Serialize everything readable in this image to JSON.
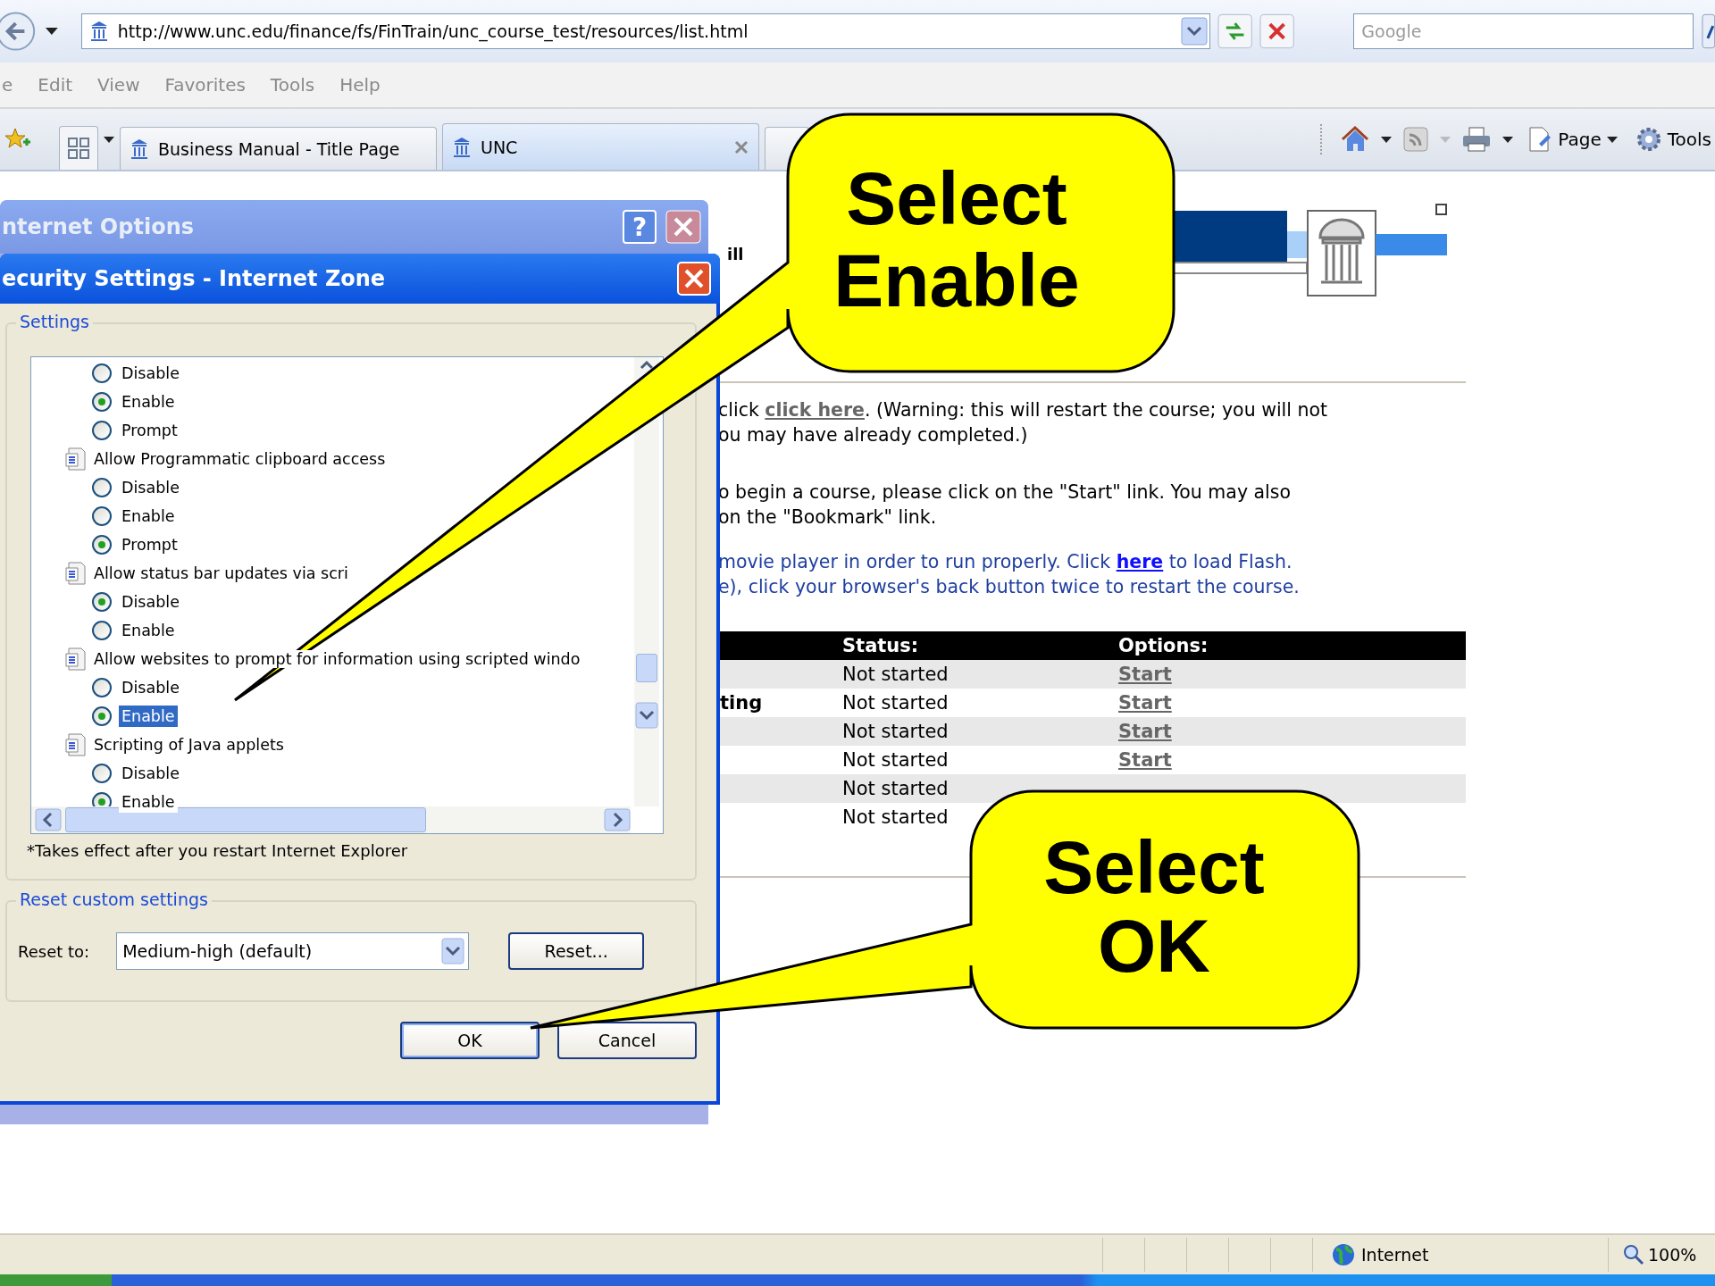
{
  "browser": {
    "address": "http://www.unc.edu/finance/fs/FinTrain/unc_course_test/resources/list.html",
    "search_placeholder": "Google",
    "menu": [
      "e",
      "Edit",
      "View",
      "Favorites",
      "Tools",
      "Help"
    ],
    "tabs": [
      {
        "label": "Business Manual - Title Page",
        "selected": false
      },
      {
        "label": "UNC",
        "selected": true
      }
    ],
    "toolbar": [
      "Page",
      "Tools"
    ]
  },
  "page": {
    "banner_fragment": "ill",
    "paragraphs": [
      {
        "color": "#000000",
        "lines": [
          {
            "before": "click ",
            "link": "click here",
            "after": ". (Warning: this will restart the course; you will not"
          },
          {
            "before": "ou may have already completed.)"
          }
        ]
      },
      {
        "color": "#000000",
        "lines": [
          {
            "before": "o begin a course, please click on the \"Start\" link. You may also"
          },
          {
            "before": "on the \"Bookmark\" link."
          }
        ]
      },
      {
        "color": "#1f3fa0",
        "lines": [
          {
            "before": " movie player in order to run properly.  Click ",
            "link": "here",
            "after": " to load Flash."
          },
          {
            "before": "e), click your browser's back button twice to restart the course."
          }
        ]
      }
    ],
    "table": {
      "columns": [
        "Status:",
        "Options:"
      ],
      "rows": [
        {
          "status": "Not started",
          "option": "Start"
        },
        {
          "name": "ting",
          "status": "Not started",
          "option": "Start"
        },
        {
          "status": "Not started",
          "option": "Start"
        },
        {
          "status": "Not started",
          "option": "Start"
        },
        {
          "status": "Not started"
        },
        {
          "status": "Not started"
        }
      ]
    }
  },
  "internet_options": {
    "title": "nternet Options",
    "help": "?"
  },
  "security_dialog": {
    "title": "ecurity Settings - Internet Zone",
    "settings_legend": "Settings",
    "settings": [
      {
        "options": [
          {
            "label": "Disable",
            "selected": false,
            "highlighted": false
          },
          {
            "label": "Enable",
            "selected": true,
            "highlighted": false
          },
          {
            "label": "Prompt",
            "selected": false,
            "highlighted": false
          }
        ]
      },
      {
        "label": "Allow Programmatic clipboard access",
        "options": [
          {
            "label": "Disable",
            "selected": false,
            "highlighted": false
          },
          {
            "label": "Enable",
            "selected": false,
            "highlighted": false
          },
          {
            "label": "Prompt",
            "selected": true,
            "highlighted": false
          }
        ]
      },
      {
        "label": "Allow status bar updates via scri",
        "options": [
          {
            "label": "Disable",
            "selected": true,
            "highlighted": false
          },
          {
            "label": "Enable",
            "selected": false,
            "highlighted": false
          }
        ]
      },
      {
        "label": "Allow websites to prompt for information using scripted windo",
        "options": [
          {
            "label": "Disable",
            "selected": false,
            "highlighted": false
          },
          {
            "label": "Enable",
            "selected": true,
            "highlighted": true
          }
        ]
      },
      {
        "label": "Scripting of Java applets",
        "options": [
          {
            "label": "Disable",
            "selected": false,
            "highlighted": false
          },
          {
            "label": "Enable",
            "selected": true,
            "highlighted": false
          }
        ]
      }
    ],
    "note": "*Takes effect after you restart Internet Explorer",
    "reset_legend": "Reset custom settings",
    "reset_label": "Reset to:",
    "reset_value": "Medium-high (default)",
    "reset_button": "Reset...",
    "buttons": [
      "OK",
      "Cancel"
    ]
  },
  "callouts": [
    {
      "lines": [
        "Select",
        "Enable"
      ]
    },
    {
      "lines": [
        "Select",
        "OK"
      ]
    }
  ],
  "status_bar": {
    "zone": "Internet",
    "zoom": "100%"
  }
}
